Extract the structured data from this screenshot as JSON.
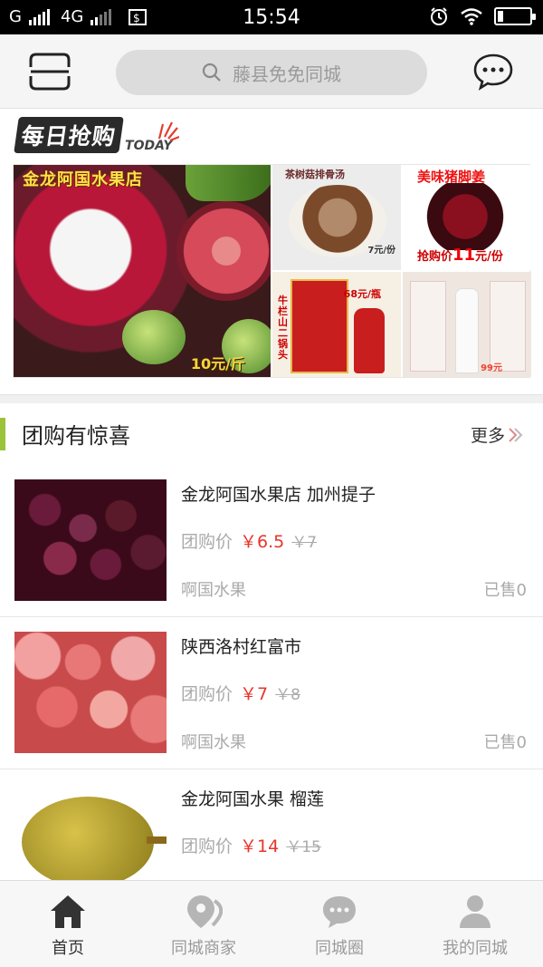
{
  "status_bar": {
    "carrier": "G",
    "network": "4G",
    "time": "15:54"
  },
  "header": {
    "search_placeholder": "藤县免免同城",
    "icons": {
      "scan": "scan-icon",
      "search": "search-icon",
      "message": "chat-icon"
    }
  },
  "daily_deals": {
    "title_zh": "每日抢购",
    "title_en": "TODAY",
    "main": {
      "shop": "金龙阿国水果店",
      "price": "10元/斤"
    },
    "items": [
      {
        "label": "茶树菇排骨汤",
        "price": "7元/份"
      },
      {
        "label": "美味猪脚姜",
        "price_prefix": "抢购价",
        "price_value": "11",
        "price_suffix": "元/份"
      },
      {
        "label": "牛栏山二锅头",
        "price": "68元/瓶"
      },
      {
        "label": "",
        "price": "99元"
      }
    ]
  },
  "group_buy": {
    "title": "团购有惊喜",
    "more": "更多",
    "products": [
      {
        "name": "金龙阿国水果店 加州提子",
        "price_label": "团购价",
        "price": "￥6.5",
        "original": "￥7",
        "category": "啊国水果",
        "sold": "已售0"
      },
      {
        "name": "陕西洛村红富市",
        "price_label": "团购价",
        "price": "￥7",
        "original": "￥8",
        "category": "啊国水果",
        "sold": "已售0"
      },
      {
        "name": "金龙阿国水果 榴莲",
        "price_label": "团购价",
        "price": "￥14",
        "original": "￥15",
        "category": "",
        "sold": ""
      }
    ]
  },
  "bottom_nav": {
    "items": [
      {
        "label": "首页",
        "icon": "home-icon",
        "active": true
      },
      {
        "label": "同城商家",
        "icon": "location-pin-icon",
        "active": false
      },
      {
        "label": "同城圈",
        "icon": "chat-bubble-icon",
        "active": false
      },
      {
        "label": "我的同城",
        "icon": "user-icon",
        "active": false
      }
    ]
  },
  "colors": {
    "accent_green": "#9ac33a",
    "price_red": "#e8342a",
    "nav_active": "#333333",
    "nav_inactive": "#9a9a9a"
  }
}
